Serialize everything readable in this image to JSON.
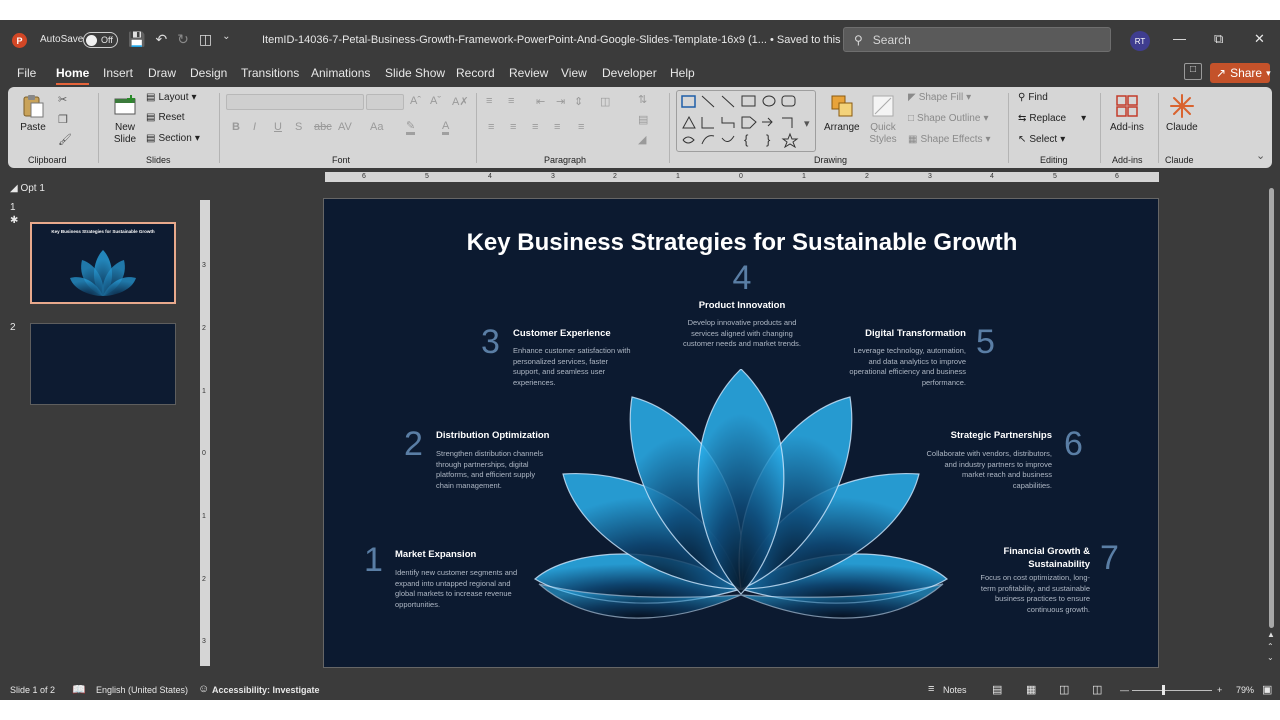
{
  "titlebar": {
    "app_logo": "P",
    "autosave_label": "AutoSave",
    "autosave_state": "Off",
    "document_title": "ItemID-14036-7-Petal-Business-Growth-Framework-PowerPoint-And-Google-Slides-Template-16x9 (1... • Saved to this PC",
    "search_placeholder": "Search",
    "user_initials": "RT"
  },
  "tabs": [
    "File",
    "Home",
    "Insert",
    "Draw",
    "Design",
    "Transitions",
    "Animations",
    "Slide Show",
    "Record",
    "Review",
    "View",
    "Developer",
    "Help"
  ],
  "active_tab": "Home",
  "share_label": "Share",
  "ribbon": {
    "clipboard": {
      "paste": "Paste",
      "label": "Clipboard"
    },
    "slides": {
      "new_slide": "New Slide",
      "layout": "Layout",
      "reset": "Reset",
      "section": "Section",
      "label": "Slides"
    },
    "font": {
      "label": "Font"
    },
    "paragraph": {
      "label": "Paragraph"
    },
    "drawing": {
      "arrange": "Arrange",
      "quick_styles": "Quick Styles",
      "shape_fill": "Shape Fill",
      "shape_outline": "Shape Outline",
      "shape_effects": "Shape Effects",
      "label": "Drawing"
    },
    "editing": {
      "find": "Find",
      "replace": "Replace",
      "select": "Select",
      "label": "Editing"
    },
    "addins": {
      "addins": "Add-ins",
      "label": "Add-ins"
    },
    "claude": {
      "claude": "Claude",
      "label": "Claude"
    }
  },
  "thumbnails": {
    "section": "Opt 1",
    "slides": [
      {
        "number": "1",
        "title": "Key Business Strategies for Sustainable Growth"
      },
      {
        "number": "2",
        "title": ""
      }
    ]
  },
  "ruler": {
    "h": [
      "6",
      "5",
      "4",
      "3",
      "2",
      "1",
      "0",
      "1",
      "2",
      "3",
      "4",
      "5",
      "6"
    ],
    "v": [
      "3",
      "2",
      "1",
      "0",
      "1",
      "2",
      "3"
    ]
  },
  "slide": {
    "title": "Key Business Strategies for Sustainable Growth",
    "items": [
      {
        "num": "1",
        "title": "Market Expansion",
        "body": "Identify new customer segments and expand into untapped regional and global markets to increase revenue opportunities."
      },
      {
        "num": "2",
        "title": "Distribution Optimization",
        "body": "Strengthen distribution channels through partnerships, digital platforms, and efficient supply chain management."
      },
      {
        "num": "3",
        "title": "Customer Experience",
        "body": "Enhance customer satisfaction with personalized services, faster support, and seamless user experiences."
      },
      {
        "num": "4",
        "title": "Product Innovation",
        "body": "Develop innovative products and services aligned with changing customer needs and market trends."
      },
      {
        "num": "5",
        "title": "Digital Transformation",
        "body": "Leverage technology, automation, and data analytics to improve operational efficiency and business performance."
      },
      {
        "num": "6",
        "title": "Strategic Partnerships",
        "body": "Collaborate with vendors, distributors, and industry partners to improve market reach and business capabilities."
      },
      {
        "num": "7",
        "title": "Financial Growth & Sustainability",
        "body": "Focus on cost optimization, long-term profitability, and sustainable business practices to ensure continuous growth."
      }
    ]
  },
  "status": {
    "slide_counter": "Slide 1 of 2",
    "language": "English (United States)",
    "accessibility": "Accessibility: Investigate",
    "notes": "Notes",
    "zoom": "79%"
  }
}
